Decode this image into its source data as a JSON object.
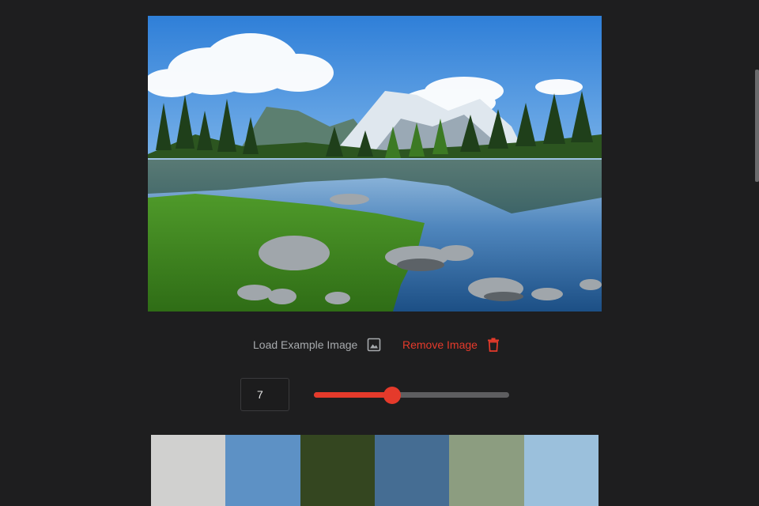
{
  "image": {
    "subject": "mountain-lake-landscape"
  },
  "actions": {
    "load_label": "Load Example Image",
    "load_icon": "image-icon",
    "remove_label": "Remove Image",
    "remove_icon": "trash-icon"
  },
  "controls": {
    "color_count": "7",
    "slider_min": 1,
    "slider_max": 16,
    "slider_value": 7
  },
  "palette": {
    "colors": [
      "#d0d0cf",
      "#5d91c5",
      "#344620",
      "#456d93",
      "#8c9d80",
      "#9bc0dc"
    ]
  },
  "theme": {
    "background": "#1e1e1f",
    "accent": "#e53a2b",
    "muted_text": "#a7aaad"
  }
}
